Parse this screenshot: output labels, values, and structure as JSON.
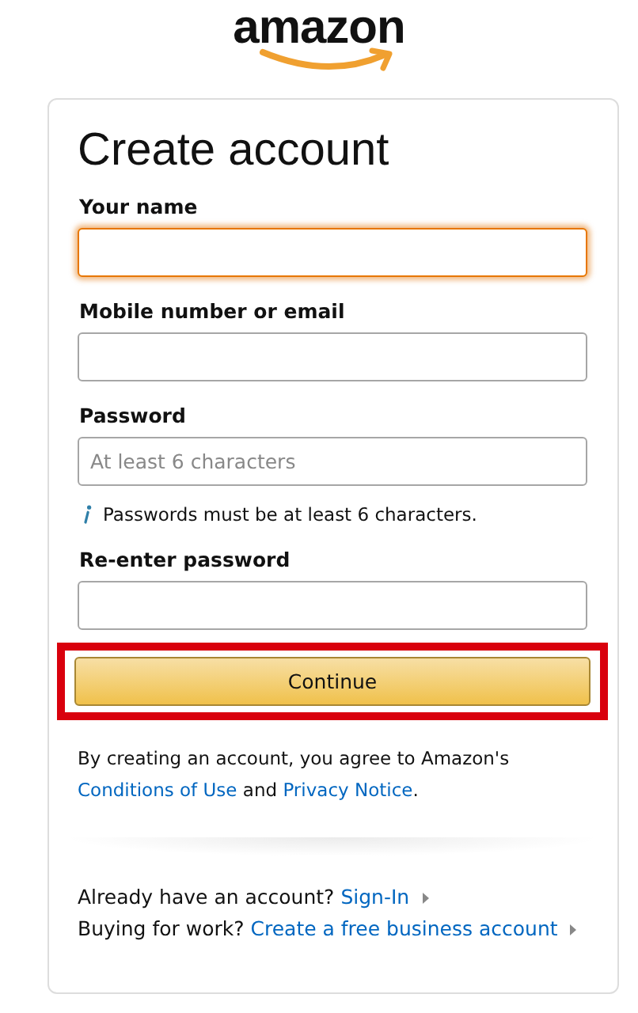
{
  "logo": {
    "text": "amazon"
  },
  "title": "Create account",
  "fields": [
    {
      "label": "Your name",
      "focused": true
    },
    {
      "label": "Mobile number or email",
      "focused": false
    },
    {
      "label": "Password",
      "focused": false,
      "placeholder": "At least 6 characters",
      "hint": "Passwords must be at least 6 characters."
    },
    {
      "label": "Re-enter password",
      "focused": false
    }
  ],
  "continue_button": {
    "label": "Continue",
    "highlighted": true
  },
  "legal": [
    {
      "kind": "text",
      "text": "By creating an account, you agree to Amazon's "
    },
    {
      "kind": "link",
      "text": "Conditions of Use"
    },
    {
      "kind": "text",
      "text": " and "
    },
    {
      "kind": "link",
      "text": "Privacy Notice"
    },
    {
      "kind": "text",
      "text": "."
    }
  ],
  "footer_lines": [
    {
      "prompt": "Already have an account?",
      "link": "Sign-In"
    },
    {
      "prompt": "Buying for work?",
      "link": "Create a free business account"
    }
  ]
}
